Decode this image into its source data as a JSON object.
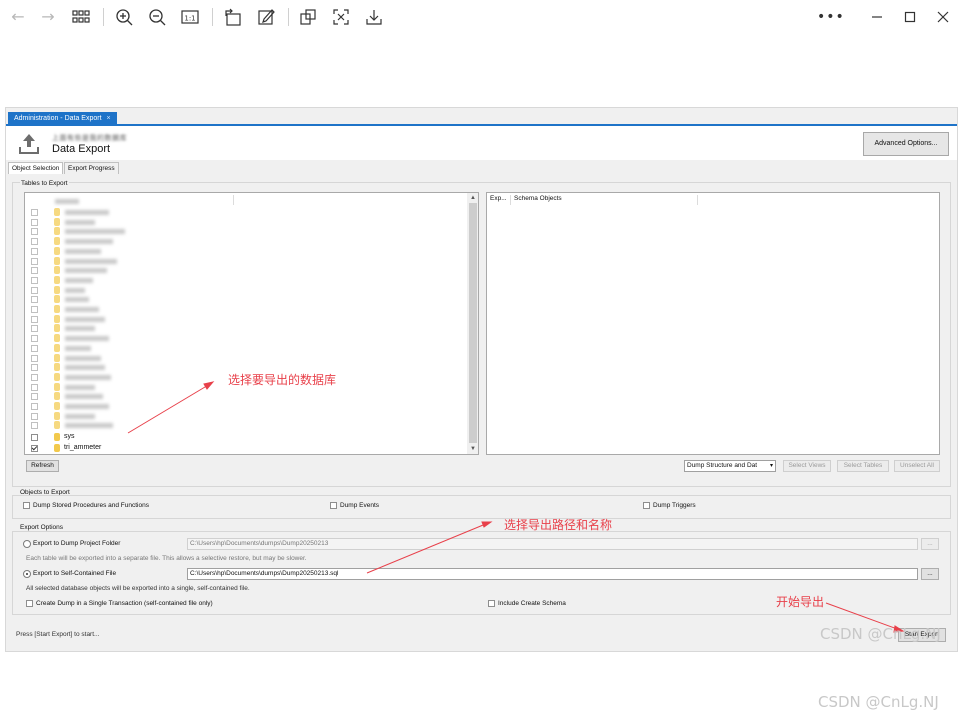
{
  "viewer": {
    "icons": [
      "back-arrow-icon",
      "forward-arrow-icon",
      "grid-view-icon",
      "zoom-in-icon",
      "zoom-out-icon",
      "actual-size-icon",
      "rotate-icon",
      "edit-icon",
      "crop-icon",
      "ocr-icon",
      "download-icon",
      "more-icon",
      "minimize-icon",
      "maximize-icon",
      "close-icon"
    ]
  },
  "tab": {
    "label": "Administration - Data Export",
    "close": "×"
  },
  "header": {
    "title": "Data Export",
    "subtitle_blurred": "上面有些是我的数据库"
  },
  "buttons": {
    "advanced": "Advanced Options...",
    "refresh": "Refresh",
    "select_views": "Select Views",
    "select_tables": "Select Tables",
    "unselect_all": "Unselect All",
    "browse": "...",
    "start_export": "Start Export"
  },
  "subtabs": [
    "Object Selection",
    "Export Progress"
  ],
  "tables_group": {
    "label": "Tables to Export"
  },
  "tree": {
    "visible_items": [
      {
        "label": "sys",
        "checked": false
      },
      {
        "label": "tri_ammeter",
        "checked": true
      }
    ]
  },
  "schema_pane": {
    "columns": [
      "Exp...",
      "Schema Objects"
    ]
  },
  "dump_select": {
    "value": "Dump Structure and Dat",
    "caret": "▾"
  },
  "objects_group": {
    "label": "Objects to Export",
    "options": [
      "Dump Stored Procedures and Functions",
      "Dump Events",
      "Dump Triggers"
    ]
  },
  "export_group": {
    "label": "Export Options",
    "project_folder": {
      "label": "Export to Dump Project Folder",
      "path": "C:\\Users\\hp\\Documents\\dumps\\Dump20250213",
      "hint": "Each table will be exported into a separate file. This allows a selective restore, but may be slower."
    },
    "self_contained": {
      "label": "Export to Self-Contained File",
      "path": "C:\\Users\\hp\\Documents\\dumps\\Dump20250213.sql",
      "hint": "All selected database objects will be exported into a single, self-contained file."
    },
    "single_transaction": "Create Dump in a Single Transaction (self-contained file only)",
    "include_schema": "Include Create Schema"
  },
  "status": "Press [Start Export] to start...",
  "annotations": {
    "select_db": "选择要导出的数据库",
    "select_path": "选择导出路径和名称",
    "start": "开始导出"
  },
  "watermark": "CSDN @CnLg.NJ",
  "colors": {
    "accent": "#1e73c8",
    "annotation": "#e8404a"
  }
}
